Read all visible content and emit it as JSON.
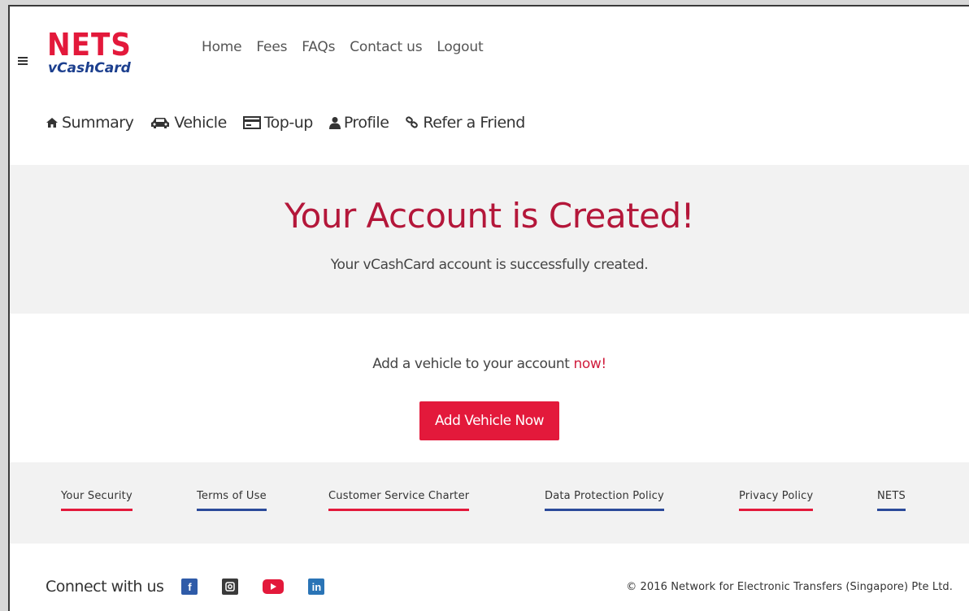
{
  "brand": {
    "logo_top": "NETS",
    "logo_bottom": "vCashCard"
  },
  "main_nav": [
    "Home",
    "Fees",
    "FAQs",
    "Contact us",
    "Logout"
  ],
  "sub_nav": [
    {
      "icon": "home-icon",
      "label": "Summary"
    },
    {
      "icon": "car-icon",
      "label": "Vehicle"
    },
    {
      "icon": "card-icon",
      "label": "Top-up"
    },
    {
      "icon": "user-icon",
      "label": "Profile"
    },
    {
      "icon": "link-icon",
      "label": "Refer a Friend"
    }
  ],
  "banner": {
    "title": "Your Account is Created!",
    "subtitle": "Your vCashCard account is successfully created."
  },
  "cta": {
    "prompt": "Add a vehicle to your account ",
    "prompt_highlight": "now!",
    "button_label": "Add Vehicle Now"
  },
  "footer_links": [
    {
      "label": "Your Security",
      "accent": "red"
    },
    {
      "label": "Terms of Use",
      "accent": "blue"
    },
    {
      "label": "Customer Service Charter",
      "accent": "red"
    },
    {
      "label": "Data Protection Policy",
      "accent": "blue"
    },
    {
      "label": "Privacy Policy",
      "accent": "red"
    },
    {
      "label": "NETS",
      "accent": "blue"
    }
  ],
  "connect": {
    "label": "Connect with us",
    "socials": [
      "facebook-icon",
      "instagram-icon",
      "youtube-icon",
      "linkedin-icon"
    ]
  },
  "copyright": "© 2016 Network for Electronic Transfers (Singapore) Pte Ltd.",
  "colors": {
    "brand_red": "#e3193b",
    "title_red": "#b4173a",
    "brand_blue": "#1c3f8e"
  }
}
